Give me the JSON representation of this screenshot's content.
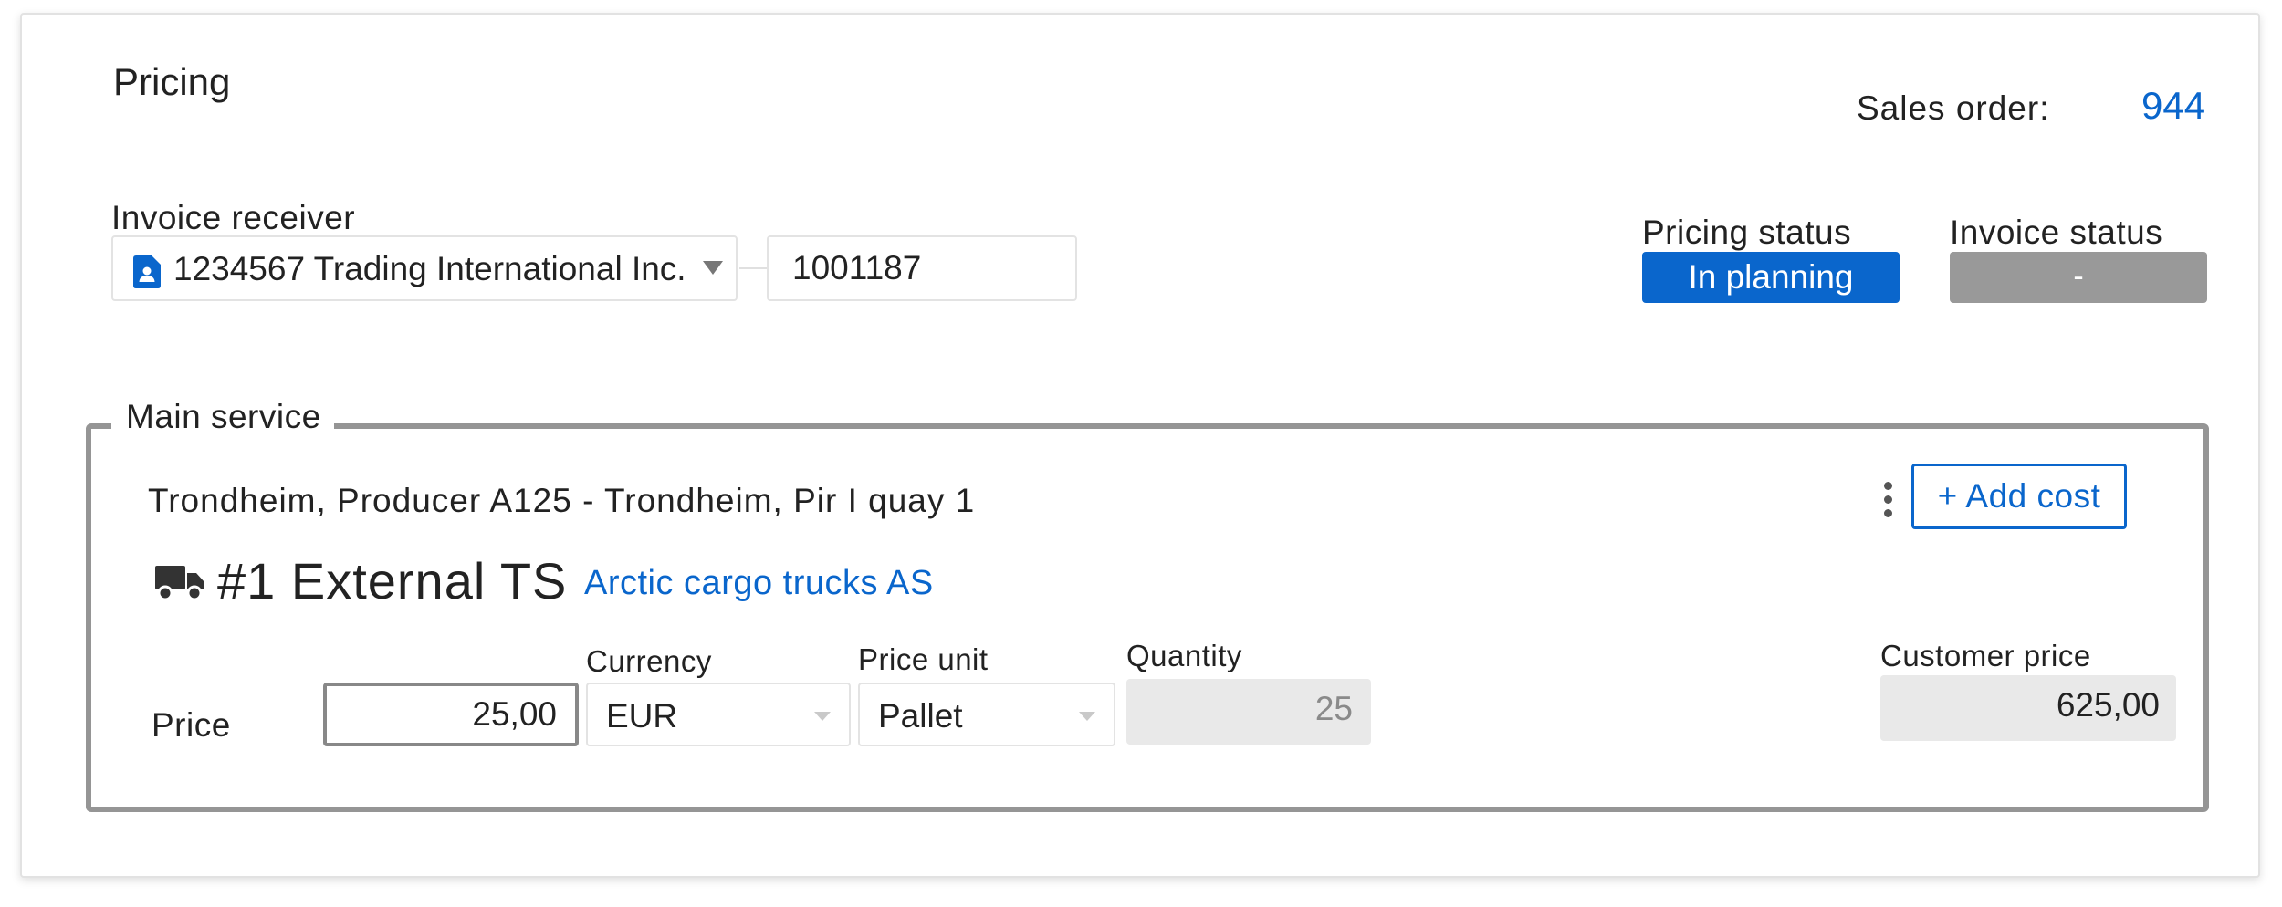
{
  "header": {
    "title": "Pricing",
    "sales_order_label": "Sales order:",
    "sales_order_value": "944"
  },
  "invoice_receiver": {
    "label": "Invoice receiver",
    "selected": "1234567 Trading International Inc.",
    "icon": "contact-document-icon",
    "customer_id": "1001187"
  },
  "statuses": {
    "pricing_label": "Pricing status",
    "pricing_value": "In planning",
    "invoice_label": "Invoice status",
    "invoice_value": "-"
  },
  "main_service": {
    "legend": "Main service",
    "route": "Trondheim, Producer A125 - Trondheim, Pir I quay 1",
    "add_cost_label": "+ Add cost",
    "service_title": "#1 External TS",
    "carrier": "Arctic cargo trucks AS",
    "price_label": "Price",
    "price_value": "25,00",
    "currency_label": "Currency",
    "currency_value": "EUR",
    "price_unit_label": "Price unit",
    "price_unit_value": "Pallet",
    "quantity_label": "Quantity",
    "quantity_value": "25",
    "customer_price_label": "Customer price",
    "customer_price_value": "625,00"
  },
  "colors": {
    "accent": "#0a66cc",
    "status_pending": "#999999",
    "fieldset_border": "#959595"
  }
}
